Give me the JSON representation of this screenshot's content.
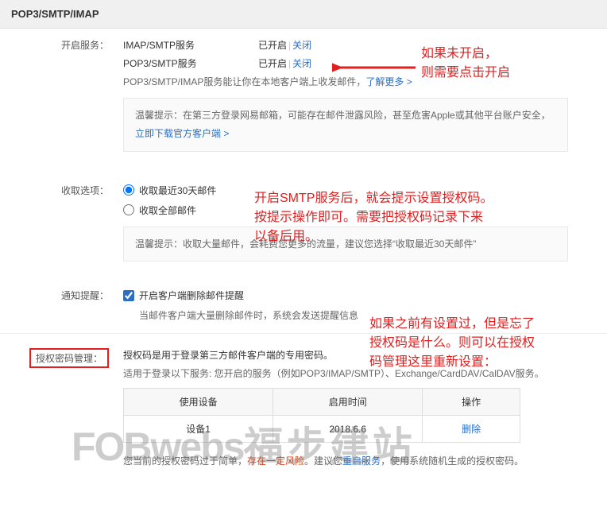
{
  "header": {
    "title": "POP3/SMTP/IMAP"
  },
  "services": {
    "label": "开启服务：",
    "rows": [
      {
        "name": "IMAP/SMTP服务",
        "status": "已开启",
        "action": "关闭"
      },
      {
        "name": "POP3/SMTP服务",
        "status": "已开启",
        "action": "关闭"
      }
    ],
    "desc_prefix": "POP3/SMTP/IMAP服务能让你在本地客户端上收发邮件，",
    "desc_link": "了解更多 >",
    "tip_prefix": "温馨提示：在第三方登录网易邮箱，可能存在邮件泄露风险，甚至危害Apple或其他平台账户安全，",
    "tip_link": "立即下载官方客户端 >"
  },
  "receive": {
    "label": "收取选项：",
    "opt1": "收取最近30天邮件",
    "opt2": "收取全部邮件",
    "tip": "温馨提示：收取大量邮件，会耗费您更多的流量，建议您选择“收取最近30天邮件”"
  },
  "notify": {
    "label": "通知提醒：",
    "cb": "开启客户端删除邮件提醒",
    "sub": "当邮件客户端大量删除邮件时，系统会发送提醒信息"
  },
  "auth": {
    "label": "授权密码管理：",
    "line1": "授权码是用于登录第三方邮件客户端的专用密码。",
    "line2": "适用于登录以下服务: 您开启的服务（例如POP3/IMAP/SMTP）、Exchange/CardDAV/CalDAV服务。",
    "th1": "使用设备",
    "th2": "启用时间",
    "th3": "操作",
    "td1": "设备1",
    "td2": "2018.6.6",
    "td3": "删除",
    "foot_a": "您当前的授权密码过于简单，",
    "foot_b": "存在一定风险",
    "foot_c": "。建议您",
    "foot_d": "重启服务",
    "foot_e": "，使用系统随机生成的授权密码。"
  },
  "annotations": {
    "a1": "如果未开启，\n则需要点击开启",
    "a2": "开启SMTP服务后，就会提示设置授权码。\n按提示操作即可。需要把授权码记录下来\n以备后用。",
    "a3": "如果之前有设置过，但是忘了\n授权码是什么。则可以在授权\n码管理这里重新设置："
  },
  "watermark": {
    "en": "FOBwebs",
    "cn": "福步建站"
  }
}
